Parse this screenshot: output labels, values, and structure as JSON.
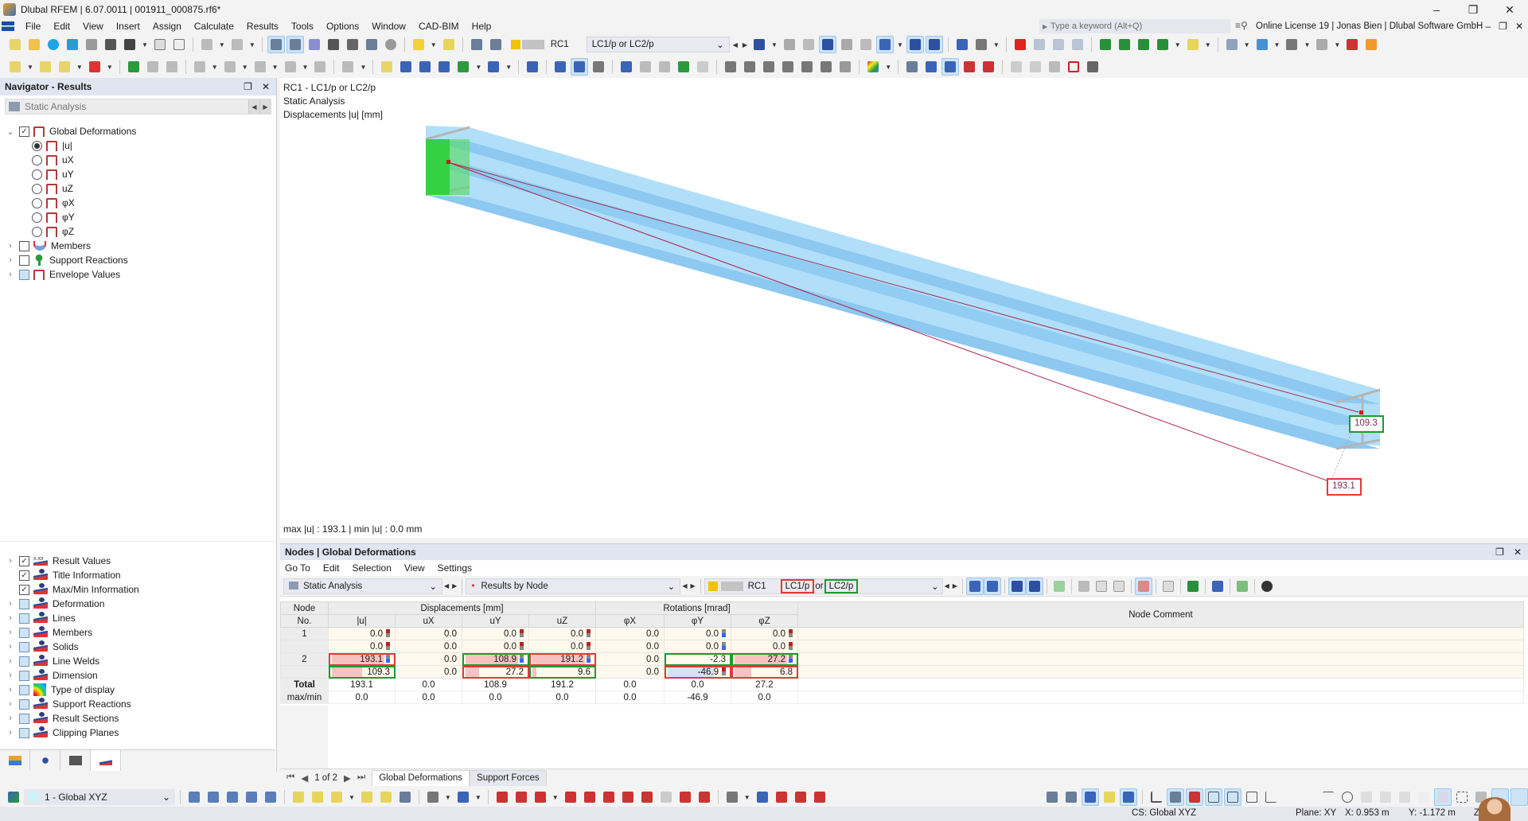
{
  "window": {
    "title": "Dlubal RFEM | 6.07.0011 | 001911_000875.rf6*",
    "controls": [
      "minimize",
      "restore",
      "close"
    ]
  },
  "menu": {
    "items": [
      "File",
      "Edit",
      "View",
      "Insert",
      "Assign",
      "Calculate",
      "Results",
      "Tools",
      "Options",
      "Window",
      "CAD-BIM",
      "Help"
    ],
    "search_placeholder": "Type a keyword (Alt+Q)",
    "license": "Online License 19 | Jonas Bien | Dlubal Software GmbH"
  },
  "toolbar": {
    "load_combination_code": "RC1",
    "load_combination_name": "LC1/p or LC2/p",
    "rc_color": "#f2c200"
  },
  "navigator": {
    "title": "Navigator - Results",
    "analysis_combo": "Static Analysis",
    "top_tree": [
      {
        "label": "Global Deformations",
        "type": "checkbox",
        "checked": true,
        "expanded": true,
        "icon": "deformation-icon"
      },
      {
        "label": "|u|",
        "type": "radio",
        "selected": true
      },
      {
        "label": "uX",
        "type": "radio",
        "selected": false
      },
      {
        "label": "uY",
        "type": "radio",
        "selected": false
      },
      {
        "label": "uZ",
        "type": "radio",
        "selected": false
      },
      {
        "label": "φX",
        "type": "radio",
        "selected": false
      },
      {
        "label": "φY",
        "type": "radio",
        "selected": false
      },
      {
        "label": "φZ",
        "type": "radio",
        "selected": false
      },
      {
        "label": "Members",
        "type": "checkbox",
        "checked": false,
        "icon": "member-diagram-icon"
      },
      {
        "label": "Support Reactions",
        "type": "checkbox",
        "checked": false,
        "icon": "support-reaction-icon"
      },
      {
        "label": "Envelope Values",
        "type": "checkbox",
        "checked": "partial",
        "icon": "deformation-icon"
      }
    ],
    "bottom_tree": [
      {
        "label": "Result Values",
        "checked": true,
        "expandable": true,
        "icon": "result-values-icon"
      },
      {
        "label": "Title Information",
        "checked": true,
        "expandable": false,
        "icon": "display-icon"
      },
      {
        "label": "Max/Min Information",
        "checked": true,
        "expandable": false,
        "icon": "display-icon"
      },
      {
        "label": "Deformation",
        "checked": "partial",
        "expandable": true,
        "icon": "display-icon"
      },
      {
        "label": "Lines",
        "checked": "partial",
        "expandable": true,
        "icon": "display-icon"
      },
      {
        "label": "Members",
        "checked": "partial",
        "expandable": true,
        "icon": "display-icon"
      },
      {
        "label": "Solids",
        "checked": "partial",
        "expandable": true,
        "icon": "display-icon"
      },
      {
        "label": "Line Welds",
        "checked": "partial",
        "expandable": true,
        "icon": "display-icon"
      },
      {
        "label": "Dimension",
        "checked": "partial",
        "expandable": true,
        "icon": "display-icon"
      },
      {
        "label": "Type of display",
        "checked": "partial",
        "expandable": true,
        "icon": "color-scale-icon"
      },
      {
        "label": "Support Reactions",
        "checked": "partial",
        "expandable": true,
        "icon": "display-icon"
      },
      {
        "label": "Result Sections",
        "checked": "partial",
        "expandable": true,
        "icon": "display-icon"
      },
      {
        "label": "Clipping Planes",
        "checked": "partial",
        "expandable": true,
        "icon": "display-icon"
      }
    ]
  },
  "viewport": {
    "info_lines": [
      "RC1 - LC1/p or LC2/p",
      "Static Analysis",
      "Displacements |u| [mm]"
    ],
    "maxmin": "max |u| : 193.1 | min |u| : 0.0 mm",
    "labels": [
      {
        "text": "109.3",
        "highlight": "green"
      },
      {
        "text": "193.1",
        "highlight": "red"
      }
    ]
  },
  "results": {
    "title": "Nodes | Global Deformations",
    "menu": [
      "Go To",
      "Edit",
      "Selection",
      "View",
      "Settings"
    ],
    "analysis_combo": "Static Analysis",
    "results_by_combo": "Results by Node",
    "rc_code": "RC1",
    "lc1": "LC1/p",
    "or_text": "or",
    "lc2": "LC2/p",
    "group_headers": {
      "node": "Node",
      "displacements": "Displacements [mm]",
      "rotations": "Rotations [mrad]",
      "comment": "Node Comment"
    },
    "columns": [
      "No.",
      "|u|",
      "uX",
      "uY",
      "uZ",
      "φX",
      "φY",
      "φZ"
    ],
    "rows": [
      {
        "node": "1",
        "values": [
          "0.0",
          "0.0",
          "0.0",
          "0.0",
          "0.0",
          "0.0",
          "0.0"
        ]
      },
      {
        "node": "",
        "values": [
          "0.0",
          "0.0",
          "0.0",
          "0.0",
          "0.0",
          "0.0",
          "0.0"
        ]
      },
      {
        "node": "2",
        "values": [
          "193.1",
          "0.0",
          "108.9",
          "191.2",
          "0.0",
          "-2.3",
          "27.2"
        ]
      },
      {
        "node": "",
        "values": [
          "109.3",
          "0.0",
          "27.2",
          "9.6",
          "0.0",
          "-46.9",
          "6.8"
        ]
      }
    ],
    "total": {
      "label": "Total",
      "values": [
        "193.1",
        "0.0",
        "108.9",
        "191.2",
        "0.0",
        "0.0",
        "27.2"
      ]
    },
    "maxmin": {
      "label": "max/min",
      "values": [
        "0.0",
        "0.0",
        "0.0",
        "0.0",
        "0.0",
        "-46.9",
        "0.0"
      ]
    },
    "pager": "1 of 2",
    "tabs": [
      "Global Deformations",
      "Support Forces"
    ],
    "active_tab": "Global Deformations"
  },
  "statusbar": {
    "cs_combo": "1 - Global XYZ",
    "cs": "CS: Global XYZ",
    "plane": "Plane: XY",
    "x": "X: 0.953 m",
    "y": "Y: -1.172 m",
    "z": "Z"
  }
}
